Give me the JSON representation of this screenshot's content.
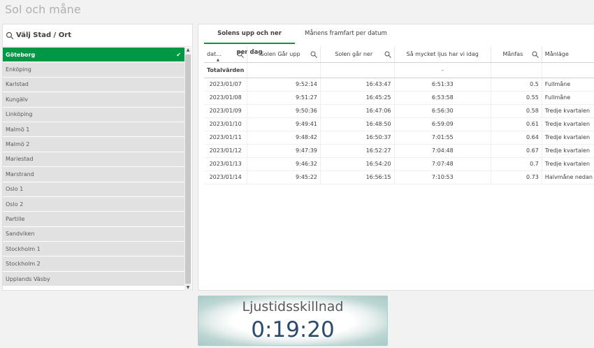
{
  "app": {
    "title": "Sol och måne"
  },
  "filter": {
    "title": "Välj Stad / Ort",
    "items": [
      {
        "label": "Göteborg",
        "selected": true
      },
      {
        "label": "Enköping"
      },
      {
        "label": "Karlstad"
      },
      {
        "label": "Kungälv"
      },
      {
        "label": "Linköping"
      },
      {
        "label": "Malmö 1"
      },
      {
        "label": "Malmö 2"
      },
      {
        "label": "Mariestad"
      },
      {
        "label": "Marstrand"
      },
      {
        "label": "Oslo 1"
      },
      {
        "label": "Oslo 2"
      },
      {
        "label": "Partille"
      },
      {
        "label": "Sandviken"
      },
      {
        "label": "Stockholm 1"
      },
      {
        "label": "Stockholm 2"
      },
      {
        "label": "Upplands Väsby"
      }
    ]
  },
  "tabs": [
    {
      "label": "Solens upp och ner per dag",
      "active": true
    },
    {
      "label": "Månens framfart per datum",
      "active": false
    }
  ],
  "table": {
    "headers": [
      "dat…",
      "Solen Går upp",
      "Solen går ner",
      "Så mycket ljus har vi idag",
      "Månfas",
      "Månläge"
    ],
    "totals_label": "Totalvärden",
    "totals_value": "-",
    "rows": [
      [
        "2023/01/07",
        "9:52:14",
        "16:43:47",
        "6:51:33",
        "0.5",
        "Fullmåne"
      ],
      [
        "2023/01/08",
        "9:51:27",
        "16:45:25",
        "6:53:58",
        "0.55",
        "Fullmåne"
      ],
      [
        "2023/01/09",
        "9:50:36",
        "16:47:06",
        "6:56:30",
        "0.58",
        "Tredje kvartalen"
      ],
      [
        "2023/01/10",
        "9:49:41",
        "16:48:50",
        "6:59:09",
        "0.61",
        "Tredje kvartalen"
      ],
      [
        "2023/01/11",
        "9:48:42",
        "16:50:37",
        "7:01:55",
        "0.64",
        "Tredje kvartalen"
      ],
      [
        "2023/01/12",
        "9:47:39",
        "16:52:27",
        "7:04:48",
        "0.67",
        "Tredje kvartalen"
      ],
      [
        "2023/01/13",
        "9:46:32",
        "16:54:20",
        "7:07:48",
        "0.7",
        "Tredje kvartalen"
      ],
      [
        "2023/01/14",
        "9:45:22",
        "16:56:15",
        "7:10:53",
        "0.73",
        "Halvmåne nedan"
      ]
    ]
  },
  "kpi": {
    "label": "Ljustidsskillnad",
    "value": "0:19:20"
  },
  "colors": {
    "accent": "#009845",
    "kpi_text": "#2c4a6b"
  }
}
